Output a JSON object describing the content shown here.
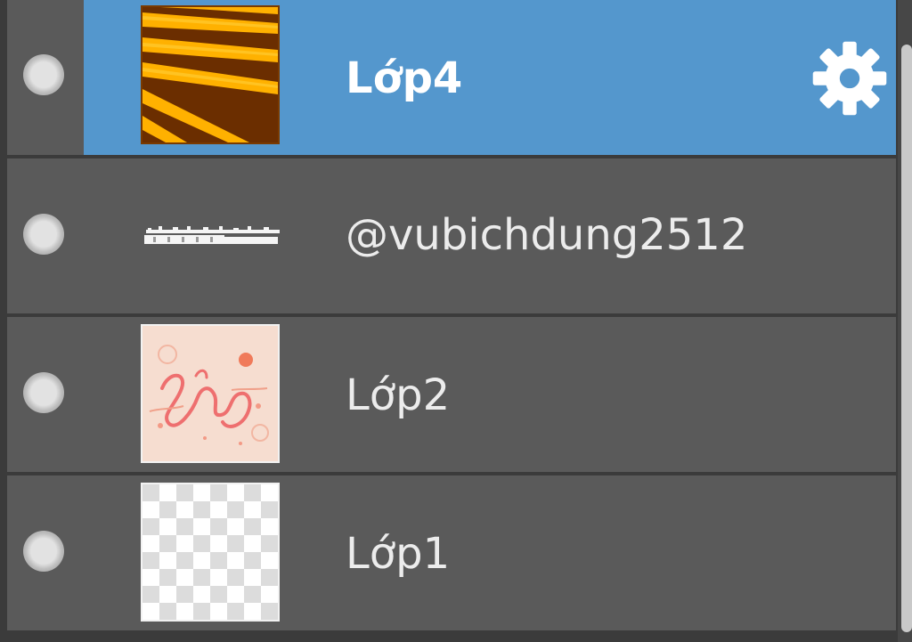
{
  "layers": [
    {
      "name": "Lớp4",
      "selected": true,
      "thumbnail": "orange-stripes",
      "has_settings": true
    },
    {
      "name": "@vubichdung2512",
      "selected": false,
      "thumbnail": "white-text-strip",
      "has_settings": false
    },
    {
      "name": "Lớp2",
      "selected": false,
      "thumbnail": "peach-lettering",
      "has_settings": false
    },
    {
      "name": "Lớp1",
      "selected": false,
      "thumbnail": "transparent-checker",
      "has_settings": false
    }
  ],
  "colors": {
    "selection": "#5497cd",
    "row": "#5a5a5a",
    "background": "#3b3b3b"
  },
  "icons": {
    "visibility": "circle-dot-icon",
    "settings": "gear-icon"
  }
}
